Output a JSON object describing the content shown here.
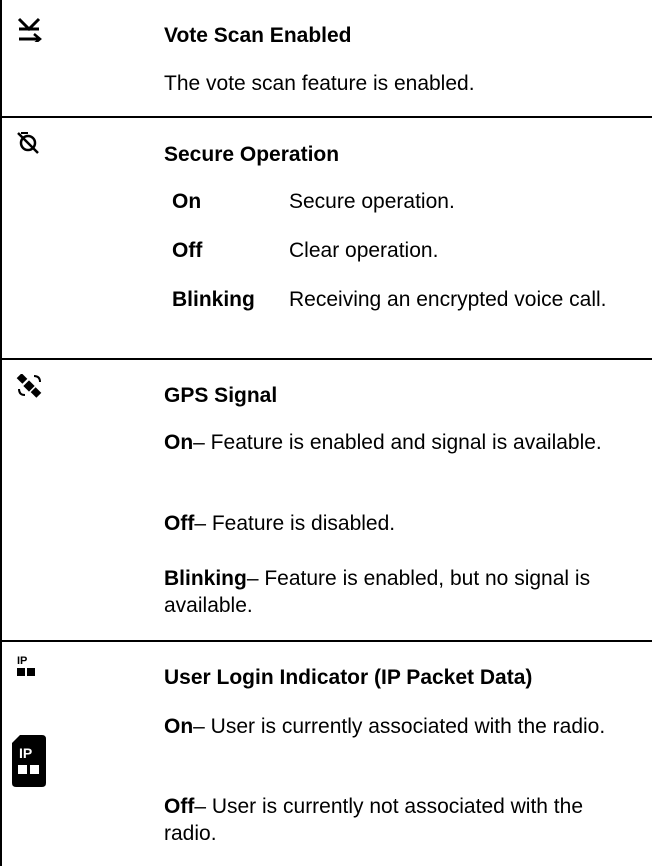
{
  "rows": [
    {
      "icon": "vote-scan-icon",
      "title": "Vote Scan Enabled",
      "description": "The vote scan feature is enabled."
    },
    {
      "icon": "secure-operation-icon",
      "title": "Secure Operation",
      "states": [
        {
          "term": "On",
          "desc": "Secure operation."
        },
        {
          "term": "Off",
          "desc": "Clear operation."
        },
        {
          "term": "Blinking",
          "desc": "Receiving an encrypted voice call."
        }
      ]
    },
    {
      "icon": "gps-satellite-icon",
      "title": "GPS Signal",
      "items": [
        {
          "term": "On",
          "text": "– Feature is enabled and signal is available."
        },
        {
          "term": "Off",
          "text": "– Feature is disabled."
        },
        {
          "term": "Blinking",
          "text": "– Feature is enabled, but no signal is available."
        }
      ]
    },
    {
      "icon": "ip-login-icon",
      "icon_text": "IP",
      "secondary_icon": "ip-login-large-icon",
      "title": "User Login Indicator (IP Packet Data)",
      "items": [
        {
          "term": "On",
          "text": "– User is currently associated with the radio."
        },
        {
          "term": "Off",
          "text": "– User is currently not associated with the radio."
        }
      ]
    }
  ]
}
